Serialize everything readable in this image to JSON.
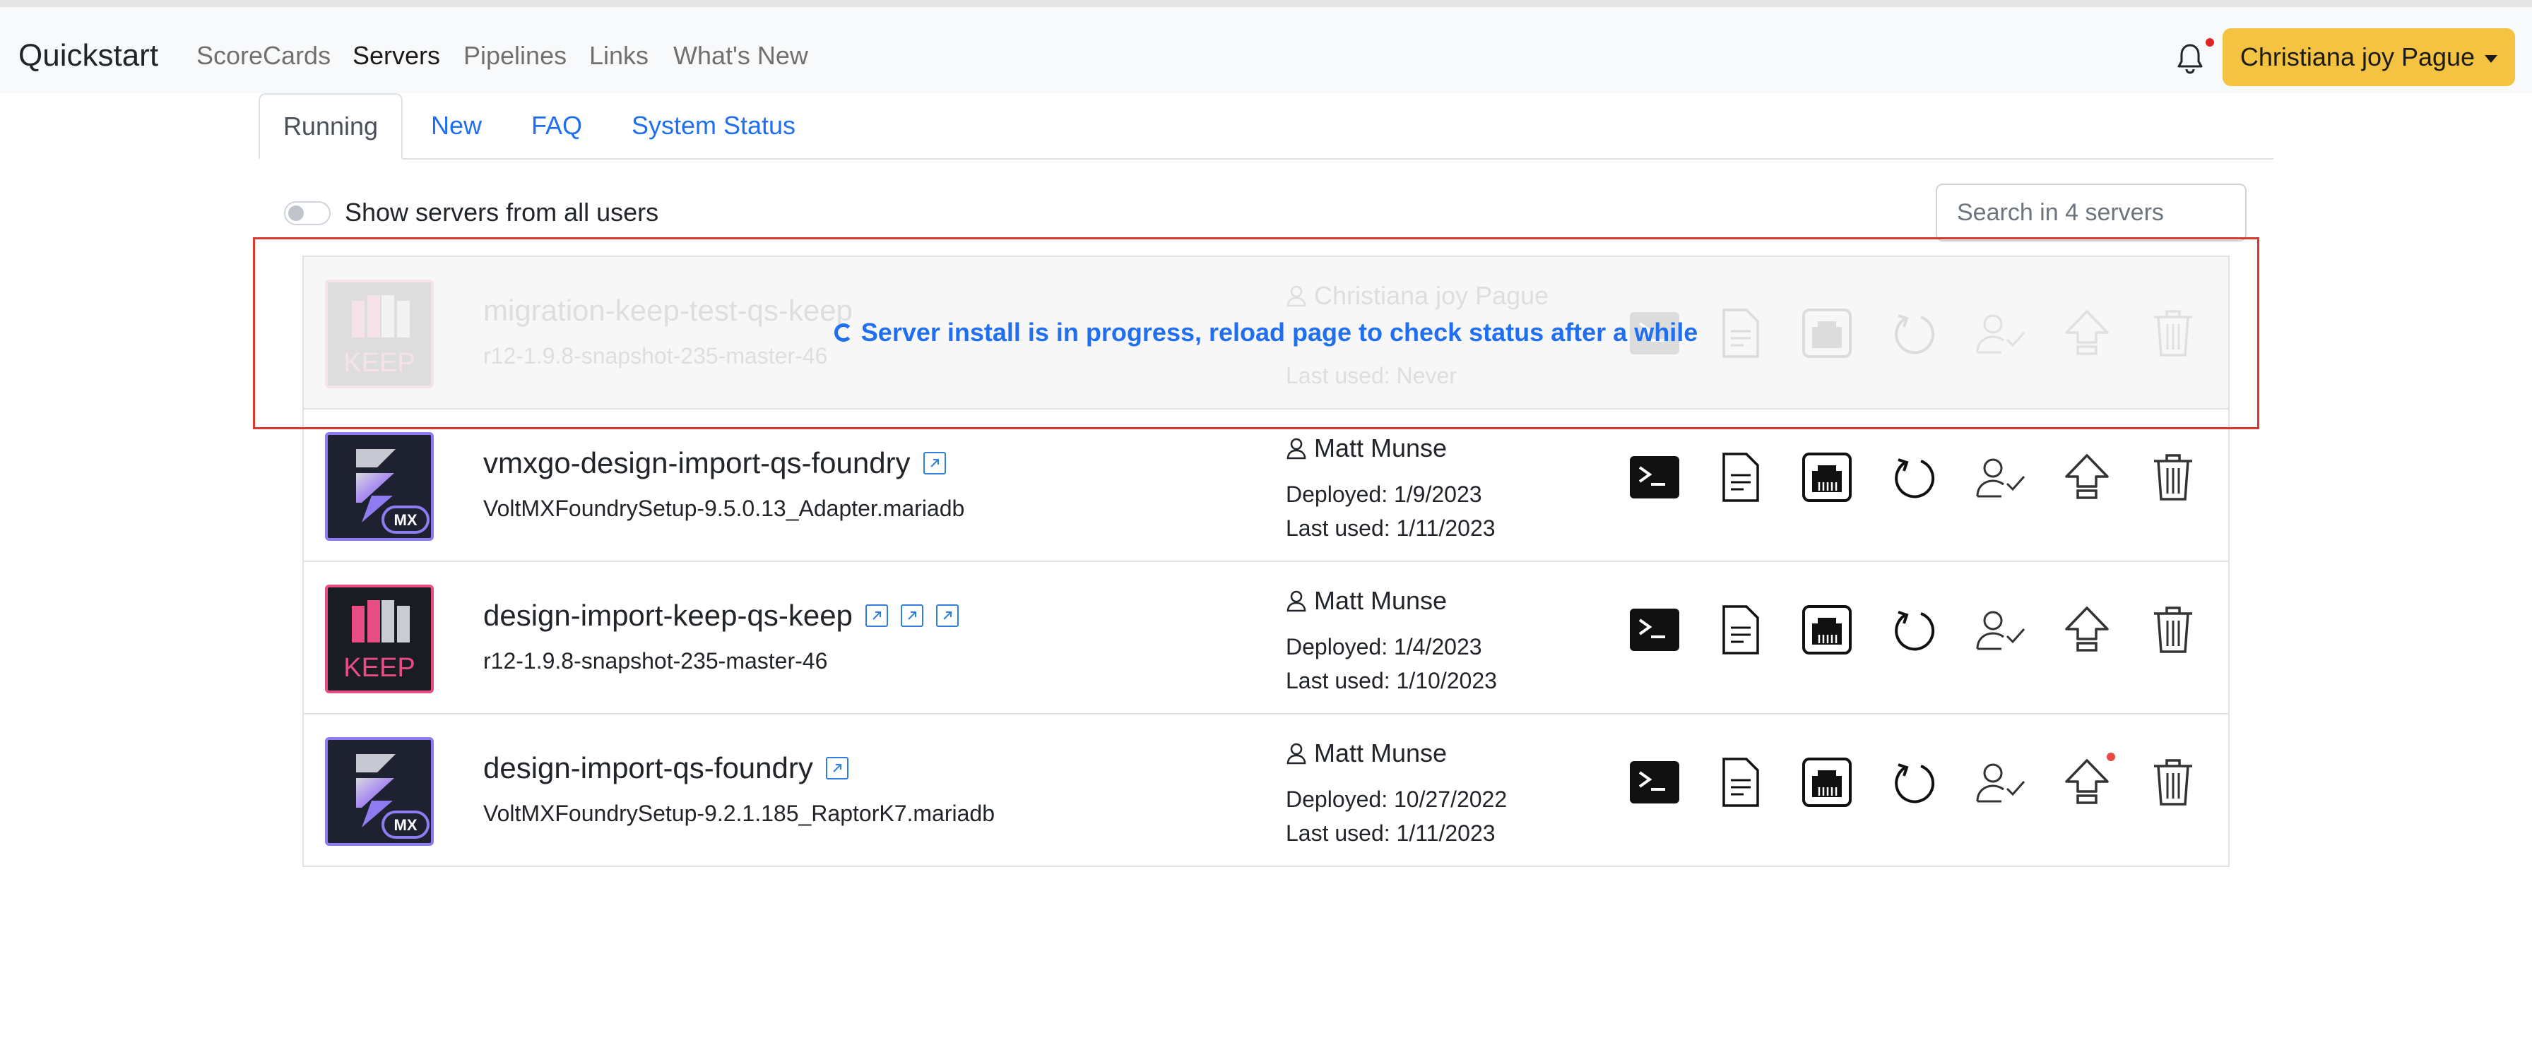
{
  "app": {
    "brand": "Quickstart",
    "nav": [
      "ScoreCards",
      "Servers",
      "Pipelines",
      "Links",
      "What's New"
    ],
    "active_nav": "Servers",
    "user_name": "Christiana joy Pague"
  },
  "tabs": [
    "Running",
    "New",
    "FAQ",
    "System Status"
  ],
  "active_tab": "Running",
  "filters": {
    "toggle_label": "Show servers from all users",
    "search_placeholder": "Search in 4 servers"
  },
  "servers": [
    {
      "name": "migration-keep-test-qs-keep",
      "version": "r12-1.9.8-snapshot-235-master-46",
      "owner": "Christiana joy Pague",
      "deployed": "",
      "last_used": "Last used: Never",
      "logo": "keep",
      "logo_text": "KEEP",
      "status_message": "Server install is in progress, reload page to check status after a while"
    },
    {
      "name": "vmxgo-design-import-qs-foundry",
      "version": "VoltMXFoundrySetup-9.5.0.13_Adapter.mariadb",
      "owner": "Matt Munse",
      "deployed": "Deployed: 1/9/2023",
      "last_used": "Last used: 1/11/2023",
      "logo": "foundry",
      "logo_text": "MX"
    },
    {
      "name": "design-import-keep-qs-keep",
      "version": "r12-1.9.8-snapshot-235-master-46",
      "owner": "Matt Munse",
      "deployed": "Deployed: 1/4/2023",
      "last_used": "Last used: 1/10/2023",
      "logo": "keep",
      "logo_text": "KEEP"
    },
    {
      "name": "design-import-qs-foundry",
      "version": "VoltMXFoundrySetup-9.2.1.185_RaptorK7.mariadb",
      "owner": "Matt Munse",
      "deployed": "Deployed: 10/27/2022",
      "last_used": "Last used: 1/11/2023",
      "logo": "foundry",
      "logo_text": "MX"
    }
  ],
  "icons": {
    "actions": [
      "terminal-icon",
      "document-icon",
      "network-port-icon",
      "restart-icon",
      "user-check-icon",
      "upgrade-icon",
      "trash-icon"
    ],
    "link": "external-link-icon",
    "bell": "bell-icon",
    "user": "user-icon"
  },
  "colors": {
    "accent": "#1f6ff0",
    "user_button": "#f5c342",
    "highlight": "#d9382c",
    "keep_border": "#e84d83",
    "foundry_border": "#8c7cf0",
    "notification_dot": "#e02424"
  }
}
